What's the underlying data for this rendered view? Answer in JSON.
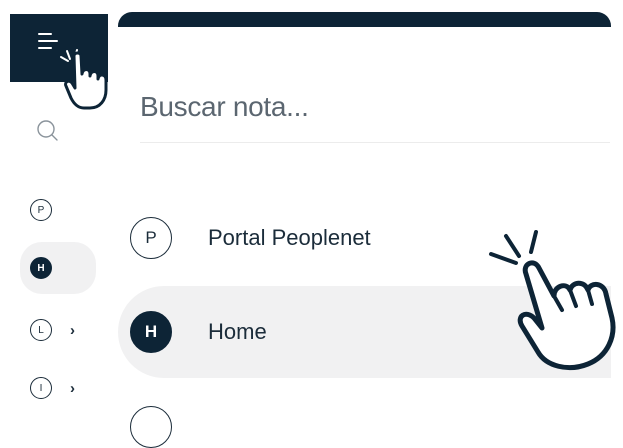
{
  "sidebar": {
    "menu_icon": "menu-lines-icon",
    "search_icon": "search-icon",
    "items": [
      {
        "letter": "P",
        "active": false,
        "expandable": false
      },
      {
        "letter": "H",
        "active": true,
        "expandable": false
      },
      {
        "letter": "L",
        "active": false,
        "expandable": true,
        "chevron": "›"
      },
      {
        "letter": "I",
        "active": false,
        "expandable": true,
        "chevron": "›"
      }
    ]
  },
  "main": {
    "search": {
      "placeholder": "Buscar nota..."
    },
    "notes": [
      {
        "letter": "P",
        "label": "Portal Peoplenet",
        "active": false
      },
      {
        "letter": "H",
        "label": "Home",
        "active": true
      }
    ]
  },
  "colors": {
    "accent": "#0d2436",
    "active_bg": "#f1f1f2"
  }
}
